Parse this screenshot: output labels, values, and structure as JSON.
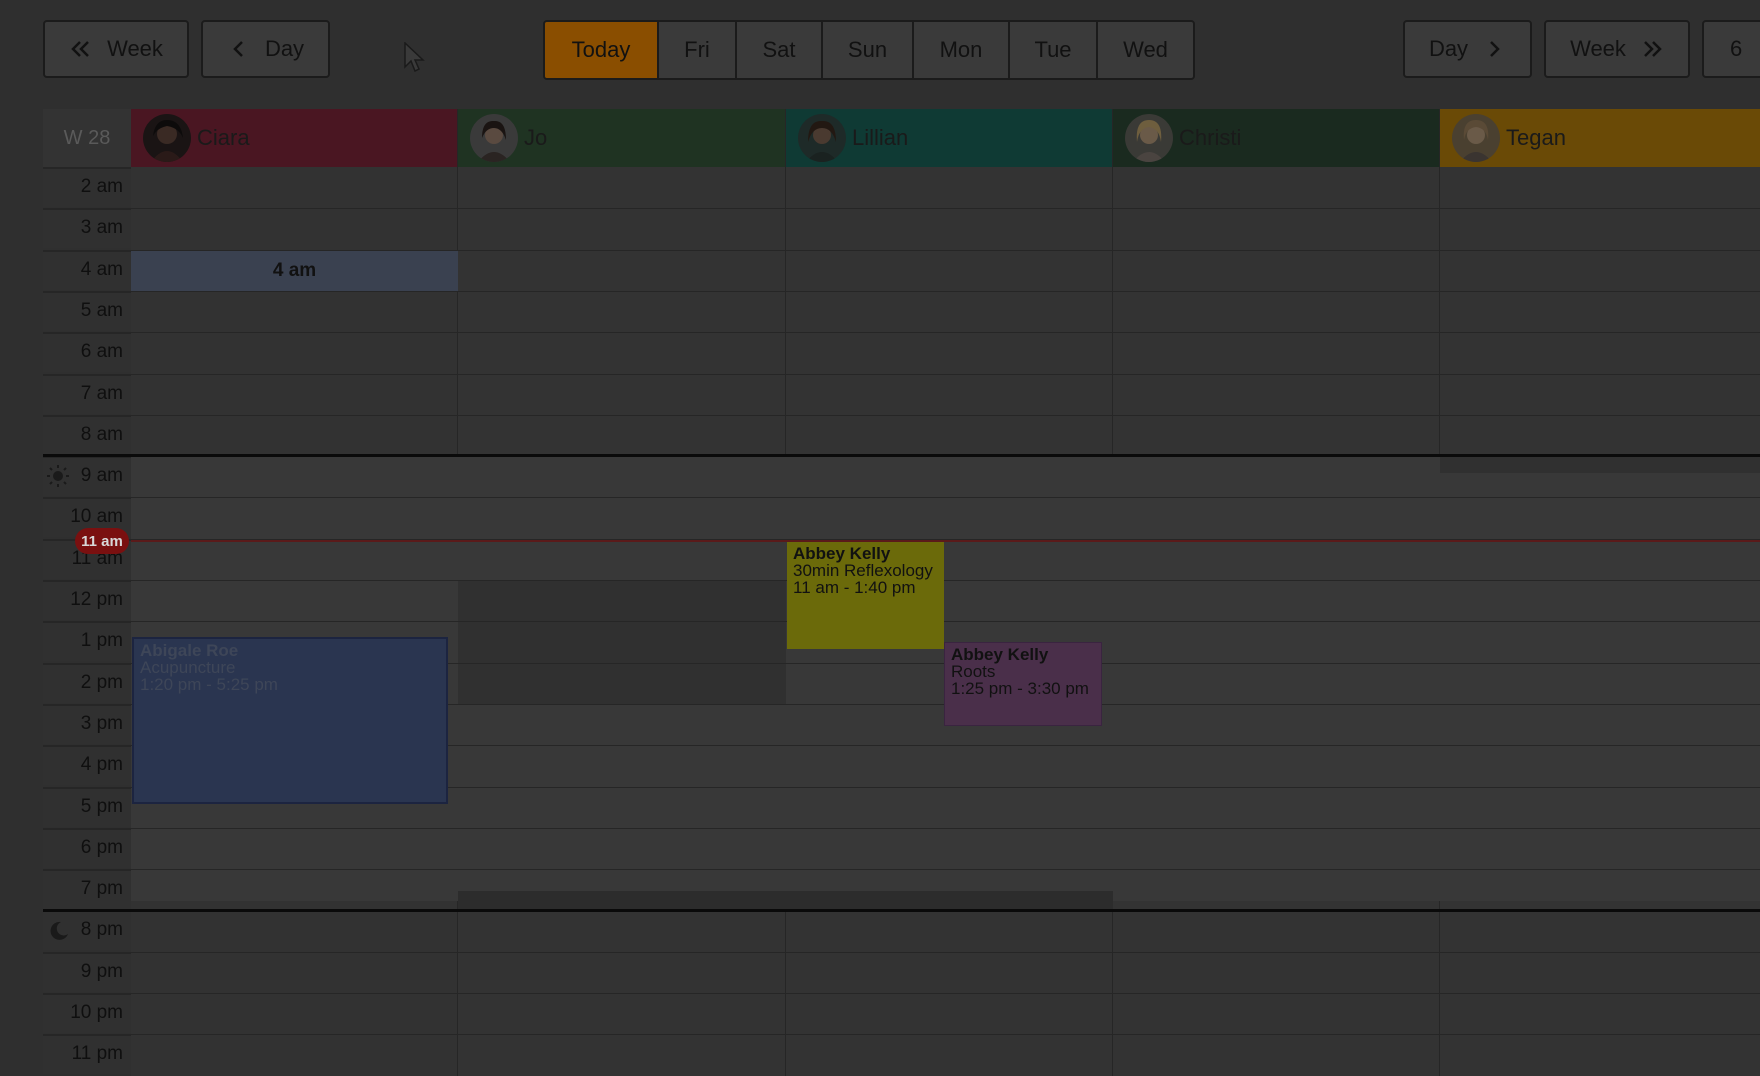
{
  "nav": {
    "prev_week": "Week",
    "prev_day": "Day",
    "next_day": "Day",
    "next_week": "Week",
    "extra": "6"
  },
  "days": [
    "Today",
    "Fri",
    "Sat",
    "Sun",
    "Mon",
    "Tue",
    "Wed"
  ],
  "calendar": {
    "week_label": "W 28",
    "now_label": "11 am",
    "hours": [
      "2 am",
      "3 am",
      "4 am",
      "5 am",
      "6 am",
      "7 am",
      "8 am",
      "9 am",
      "10 am",
      "11 am",
      "12 pm",
      "1 pm",
      "2 pm",
      "3 pm",
      "4 pm",
      "5 pm",
      "6 pm",
      "7 pm",
      "8 pm",
      "9 pm",
      "10 pm",
      "11 pm"
    ],
    "staff": [
      {
        "name": "Ciara",
        "color": "#4a1622"
      },
      {
        "name": "Jo",
        "color": "#1f3322"
      },
      {
        "name": "Lillian",
        "color": "#0f3a34"
      },
      {
        "name": "Christi",
        "color": "#1a2a1f"
      },
      {
        "name": "Tegan",
        "color": "#6a4a06"
      }
    ],
    "highlight": {
      "label": "4 am"
    },
    "events": [
      {
        "name": "Abigale Roe",
        "title": "Acupuncture",
        "time": "1:20 pm - 5:25 pm",
        "color": "#2a3550"
      },
      {
        "name": "Abbey Kelly",
        "title": "30min Reflexology",
        "time": "11 am - 1:40 pm",
        "color": "#6b6a0a"
      },
      {
        "name": "Abbey Kelly",
        "title": "Roots",
        "time": "1:25 pm - 3:30 pm",
        "color": "#4a2f4a"
      }
    ]
  }
}
